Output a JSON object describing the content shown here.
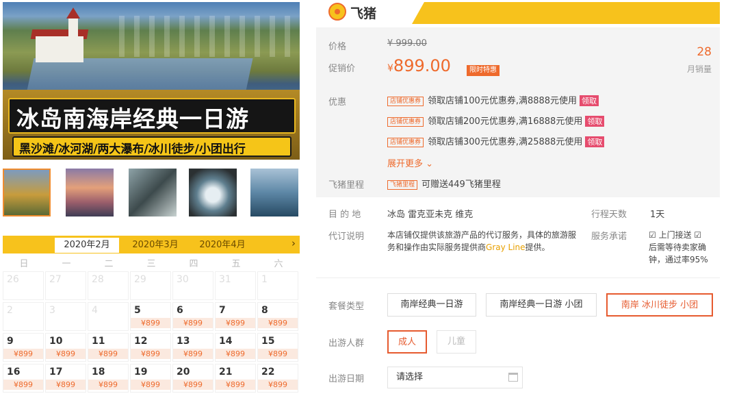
{
  "hero": {
    "title": "冰岛南海岸经典一日游",
    "subtitle": "黑沙滩/冰河湖/两大瀑布/冰川徒步/小团出行"
  },
  "thumb_count": 5,
  "calendar": {
    "months": [
      "2020年2月",
      "2020年3月",
      "2020年4月"
    ],
    "active_month": "2020年2月",
    "next_icon": "›",
    "weekdays": [
      "日",
      "一",
      "二",
      "三",
      "四",
      "五",
      "六"
    ],
    "weeks": [
      [
        {
          "d": "26",
          "g": true
        },
        {
          "d": "27",
          "g": true
        },
        {
          "d": "28",
          "g": true
        },
        {
          "d": "29",
          "g": true
        },
        {
          "d": "30",
          "g": true
        },
        {
          "d": "31",
          "g": true
        },
        {
          "d": "1",
          "g": true
        }
      ],
      [
        {
          "d": "2",
          "g": true
        },
        {
          "d": "3",
          "g": true
        },
        {
          "d": "4",
          "g": true
        },
        {
          "d": "5",
          "p": "¥899"
        },
        {
          "d": "6",
          "p": "¥899"
        },
        {
          "d": "7",
          "p": "¥899"
        },
        {
          "d": "8",
          "p": "¥899"
        }
      ],
      [
        {
          "d": "9",
          "p": "¥899"
        },
        {
          "d": "10",
          "p": "¥899"
        },
        {
          "d": "11",
          "p": "¥899"
        },
        {
          "d": "12",
          "p": "¥899"
        },
        {
          "d": "13",
          "p": "¥899"
        },
        {
          "d": "14",
          "p": "¥899"
        },
        {
          "d": "15",
          "p": "¥899"
        }
      ],
      [
        {
          "d": "16",
          "p": "¥899"
        },
        {
          "d": "17",
          "p": "¥899"
        },
        {
          "d": "18",
          "p": "¥899"
        },
        {
          "d": "19",
          "p": "¥899"
        },
        {
          "d": "20",
          "p": "¥899"
        },
        {
          "d": "21",
          "p": "¥899"
        },
        {
          "d": "22",
          "p": "¥899"
        }
      ]
    ]
  },
  "brand": {
    "name": "飞猪"
  },
  "price": {
    "label": "价格",
    "original": "¥ 999.00",
    "promo_label": "促销价",
    "currency": "¥",
    "current": "899.00",
    "tag": "限时特惠",
    "sold_count": "28",
    "sold_label": "月销量"
  },
  "coupons": {
    "label": "优惠",
    "tag": "店铺优惠券",
    "items": [
      {
        "text": "领取店铺100元优惠券,满8888元使用",
        "claim": "领取"
      },
      {
        "text": "领取店铺200元优惠券,满16888元使用",
        "claim": "领取"
      },
      {
        "text": "领取店铺300元优惠券,满25888元使用",
        "claim": "领取"
      }
    ],
    "more": "展开更多 ⌄"
  },
  "miles": {
    "label": "飞猪里程",
    "tag": "飞猪里程",
    "text": "可赠送449飞猪里程"
  },
  "info": {
    "dest_label": "目 的 地",
    "dest_value": "冰岛   雷克亚未克   维克",
    "days_label": "行程天数",
    "days_value": "1天",
    "agent_label": "代订说明",
    "agent_text_1": "本店铺仅提供该旅游产品的代订服务，具体的旅游服务和操作由实际服务提供商",
    "agent_highlight": "Gray Line",
    "agent_text_2": "提供。",
    "service_label": "服务承诺",
    "service_line1": "☑ 上门接送 ☑",
    "service_line2": "后需等待卖家确",
    "service_line3": "钟，通过率95%"
  },
  "options": {
    "package_label": "套餐类型",
    "packages": [
      "南岸经典一日游",
      "南岸经典一日游 小团",
      "南岸 冰川徒步 小团"
    ],
    "selected_package": 2,
    "people_label": "出游人群",
    "people": [
      "成人",
      "儿童"
    ],
    "date_label": "出游日期",
    "date_placeholder": "请选择"
  }
}
